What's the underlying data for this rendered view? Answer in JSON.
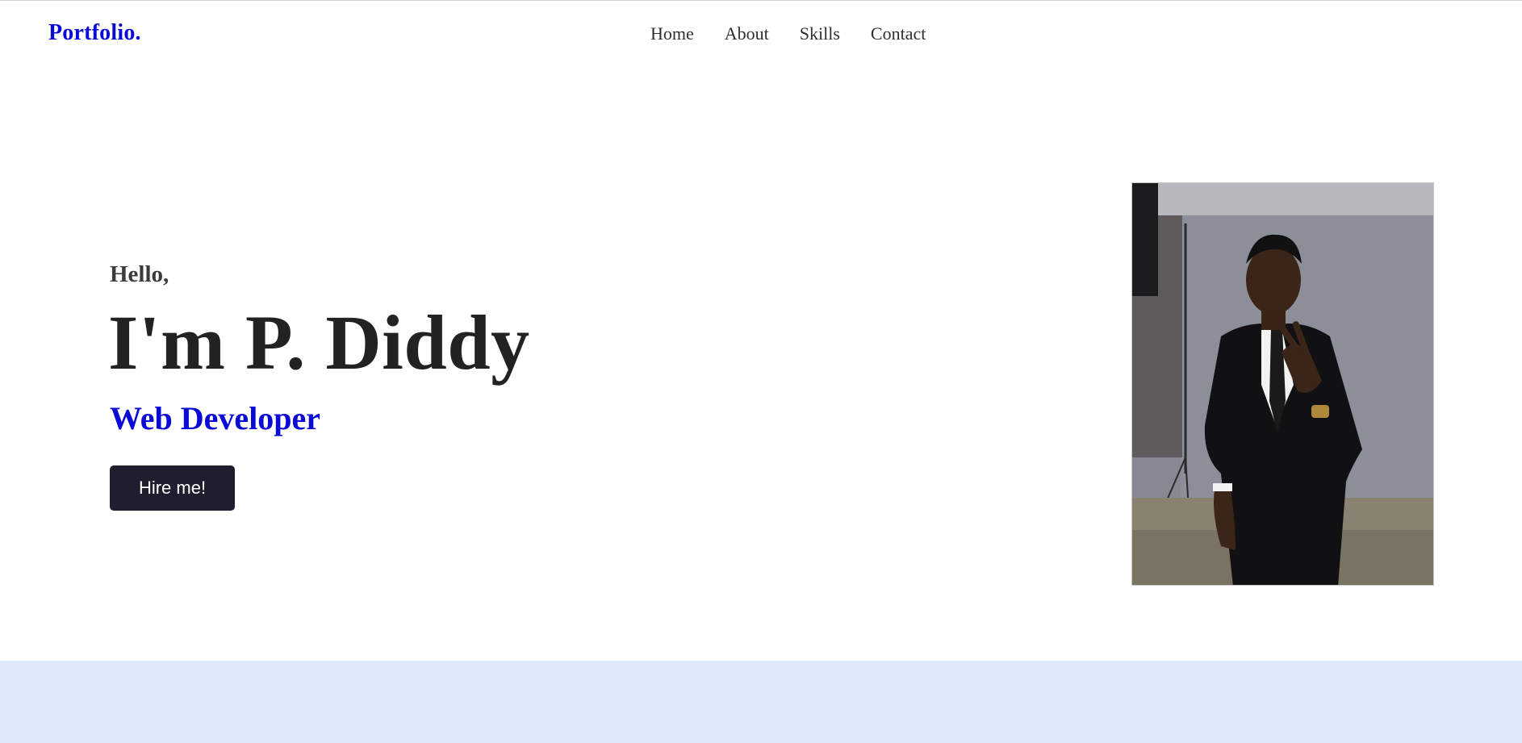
{
  "header": {
    "logo": "Portfolio.",
    "nav": {
      "home": "Home",
      "about": "About",
      "skills": "Skills",
      "contact": "Contact"
    }
  },
  "hero": {
    "greeting": "Hello,",
    "name": "I'm P. Diddy",
    "role": "Web Developer",
    "cta_label": "Hire me!"
  },
  "colors": {
    "accent": "#0a0ad6",
    "button_bg": "#1e1e2f",
    "section_bg": "#dde8fb"
  }
}
